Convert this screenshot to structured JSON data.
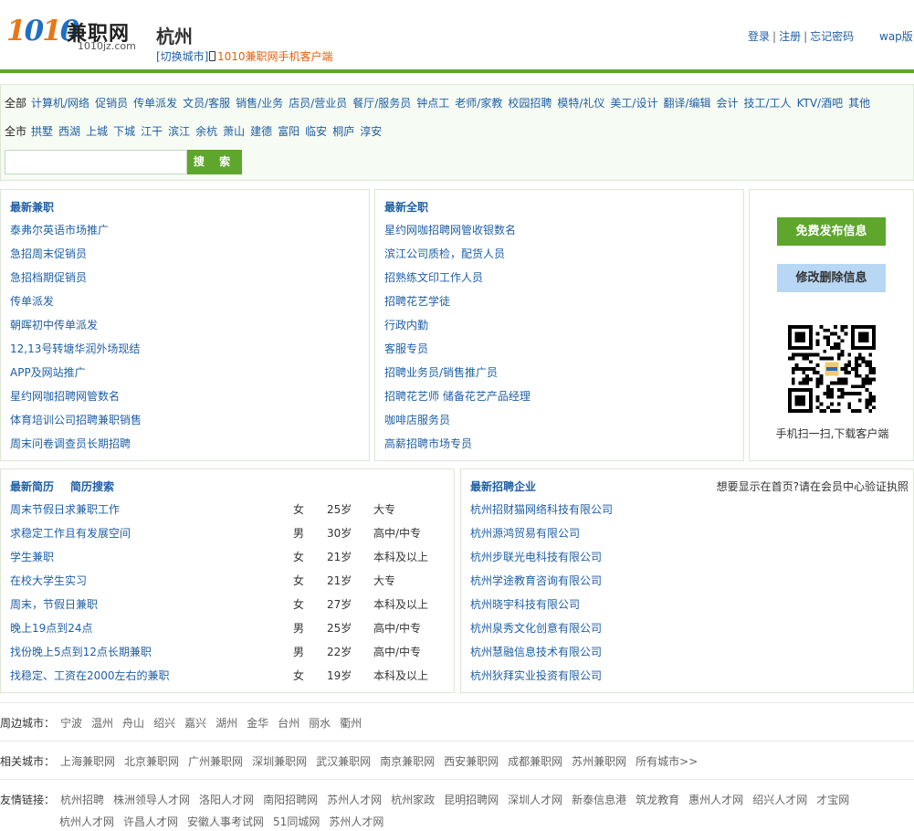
{
  "header": {
    "logo_num": "1010",
    "logo_cn": "兼职网",
    "logo_domain": "1010jz.com",
    "city": "杭州",
    "switch_city": "[切换城市]",
    "mobile_client": "1010兼职网手机客户端",
    "login": "登录",
    "register": "注册",
    "forgot": "忘记密码",
    "sep": "|",
    "wap": "wap版"
  },
  "filter": {
    "category_all": "全部",
    "categories": [
      "计算机/网络",
      "促销员",
      "传单派发",
      "文员/客服",
      "销售/业务",
      "店员/营业员",
      "餐厅/服务员",
      "钟点工",
      "老师/家教",
      "校园招聘",
      "模特/礼仪",
      "美工/设计",
      "翻译/编辑",
      "会计",
      "技工/工人",
      "KTV/酒吧",
      "其他"
    ],
    "area_all": "全市",
    "areas": [
      "拱墅",
      "西湖",
      "上城",
      "下城",
      "江干",
      "滨江",
      "余杭",
      "萧山",
      "建德",
      "富阳",
      "临安",
      "桐庐",
      "淳安"
    ],
    "search_value": "",
    "search_button": "搜 索"
  },
  "latest_jobs": {
    "title": "最新兼职",
    "items": [
      "泰弗尔英语市场推广",
      "急招周末促销员",
      "急招档期促销员",
      "传单派发",
      "朝晖初中传单派发",
      "12,13号转塘华润外场现结",
      "APP及网站推广",
      "星约网咖招聘网管数名",
      "体育培训公司招聘兼职销售",
      "周末问卷调查员长期招聘"
    ]
  },
  "latest_fulltime": {
    "title": "最新全职",
    "items": [
      "星约网咖招聘网管收银数名",
      "滨江公司质检，配货人员",
      "招熟练文印工作人员",
      "招聘花艺学徒",
      "行政内勤",
      "客服专员",
      "招聘业务员/销售推广员",
      "招聘花艺师 储备花艺产品经理",
      "咖啡店服务员",
      "高薪招聘市场专员"
    ]
  },
  "sidebar": {
    "free_post": "免费发布信息",
    "edit_delete": "修改删除信息",
    "qr_caption": "手机扫一扫,下载客户端"
  },
  "resumes": {
    "title": "最新简历",
    "search_link": "简历搜索",
    "items": [
      {
        "title": "周末节假日求兼职工作",
        "sex": "女",
        "age": "25岁",
        "edu": "大专"
      },
      {
        "title": "求稳定工作且有发展空间",
        "sex": "男",
        "age": "30岁",
        "edu": "高中/中专"
      },
      {
        "title": "学生兼职",
        "sex": "女",
        "age": "21岁",
        "edu": "本科及以上"
      },
      {
        "title": "在校大学生实习",
        "sex": "女",
        "age": "21岁",
        "edu": "大专"
      },
      {
        "title": "周末，节假日兼职",
        "sex": "女",
        "age": "27岁",
        "edu": "本科及以上"
      },
      {
        "title": "晚上19点到24点",
        "sex": "男",
        "age": "25岁",
        "edu": "高中/中专"
      },
      {
        "title": "找份晚上5点到12点长期兼职",
        "sex": "男",
        "age": "22岁",
        "edu": "高中/中专"
      },
      {
        "title": "找稳定、工资在2000左右的兼职",
        "sex": "女",
        "age": "19岁",
        "edu": "本科及以上"
      }
    ]
  },
  "companies": {
    "title": "最新招聘企业",
    "note": "想要显示在首页?请在会员中心验证执照",
    "items": [
      "杭州招财猫网络科技有限公司",
      "杭州源鸿贸易有限公司",
      "杭州步联光电科技有限公司",
      "杭州学途教育咨询有限公司",
      "杭州晓宇科技有限公司",
      "杭州泉秀文化创意有限公司",
      "杭州慧融信息技术有限公司",
      "杭州狄拜实业投资有限公司"
    ]
  },
  "nearby": {
    "label": "周边城市：",
    "items": [
      "宁波",
      "温州",
      "舟山",
      "绍兴",
      "嘉兴",
      "湖州",
      "金华",
      "台州",
      "丽水",
      "衢州"
    ]
  },
  "related": {
    "label": "相关城市：",
    "items": [
      "上海兼职网",
      "北京兼职网",
      "广州兼职网",
      "深圳兼职网",
      "武汉兼职网",
      "南京兼职网",
      "西安兼职网",
      "成都兼职网",
      "苏州兼职网",
      "所有城市>>"
    ]
  },
  "friends": {
    "label": "友情链接：",
    "items": [
      "杭州招聘",
      "株洲领导人才网",
      "洛阳人才网",
      "南阳招聘网",
      "苏州人才网",
      "杭州家政",
      "昆明招聘网",
      "深圳人才网",
      "新泰信息港",
      "筑龙教育",
      "惠州人才网",
      "绍兴人才网",
      "才宝网"
    ],
    "items2": [
      "杭州人才网",
      "许昌人才网",
      "安徽人事考试网",
      "51同城网",
      "苏州人才网"
    ]
  }
}
